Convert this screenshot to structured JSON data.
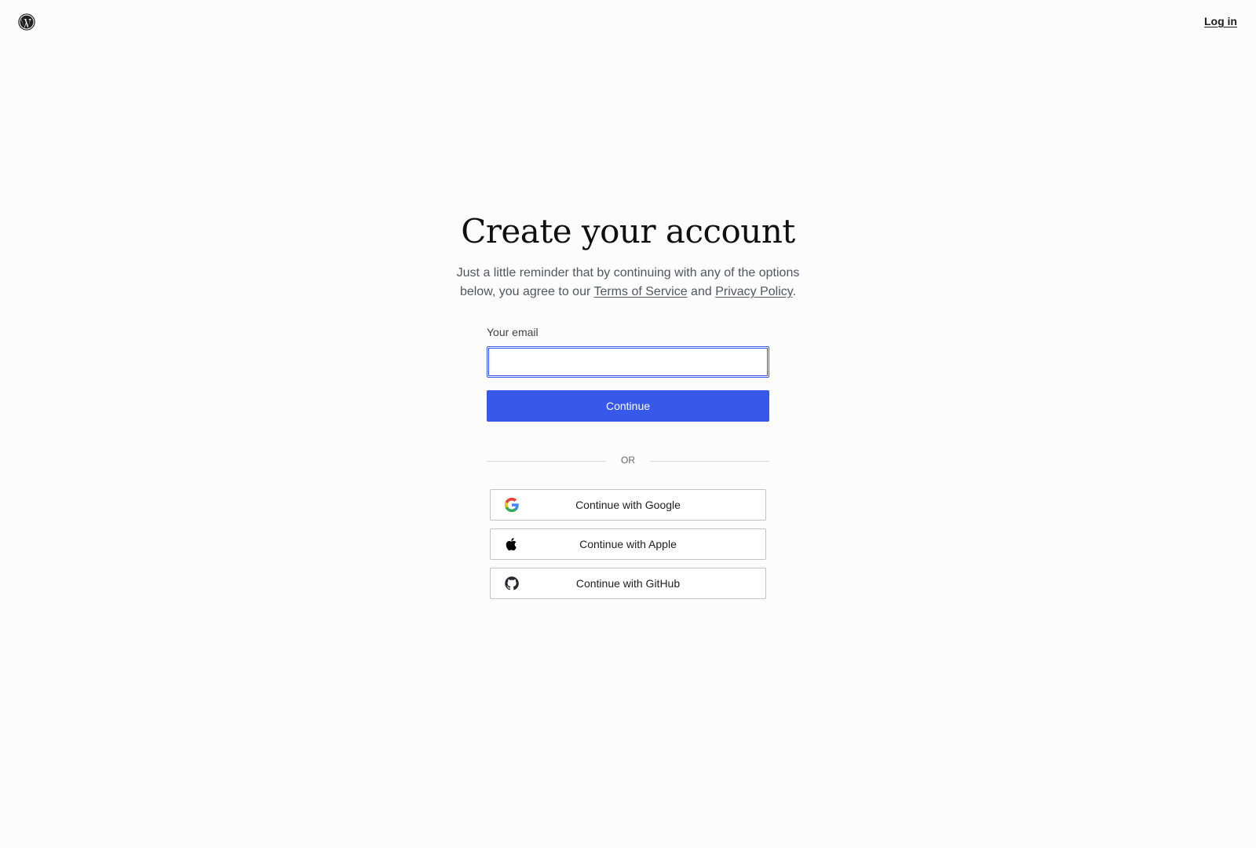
{
  "header": {
    "logo_icon": "wordpress-logo-icon",
    "login_label": "Log in"
  },
  "main": {
    "title": "Create your account",
    "subtitle_before": "Just a little reminder that by continuing with any of the options below, you agree to our ",
    "terms_link": "Terms of Service",
    "subtitle_and": " and ",
    "privacy_link": "Privacy Policy",
    "subtitle_after": "."
  },
  "form": {
    "email_label": "Your email",
    "email_value": "",
    "email_placeholder": "",
    "continue_label": "Continue"
  },
  "divider": {
    "label": "OR"
  },
  "social": {
    "google_label": "Continue with Google",
    "apple_label": "Continue with Apple",
    "github_label": "Continue with GitHub"
  },
  "colors": {
    "accent": "#3858e9",
    "background": "#fcfcfc",
    "text": "#1e1e1e",
    "muted": "#50575e",
    "border": "#c3c4c7"
  }
}
